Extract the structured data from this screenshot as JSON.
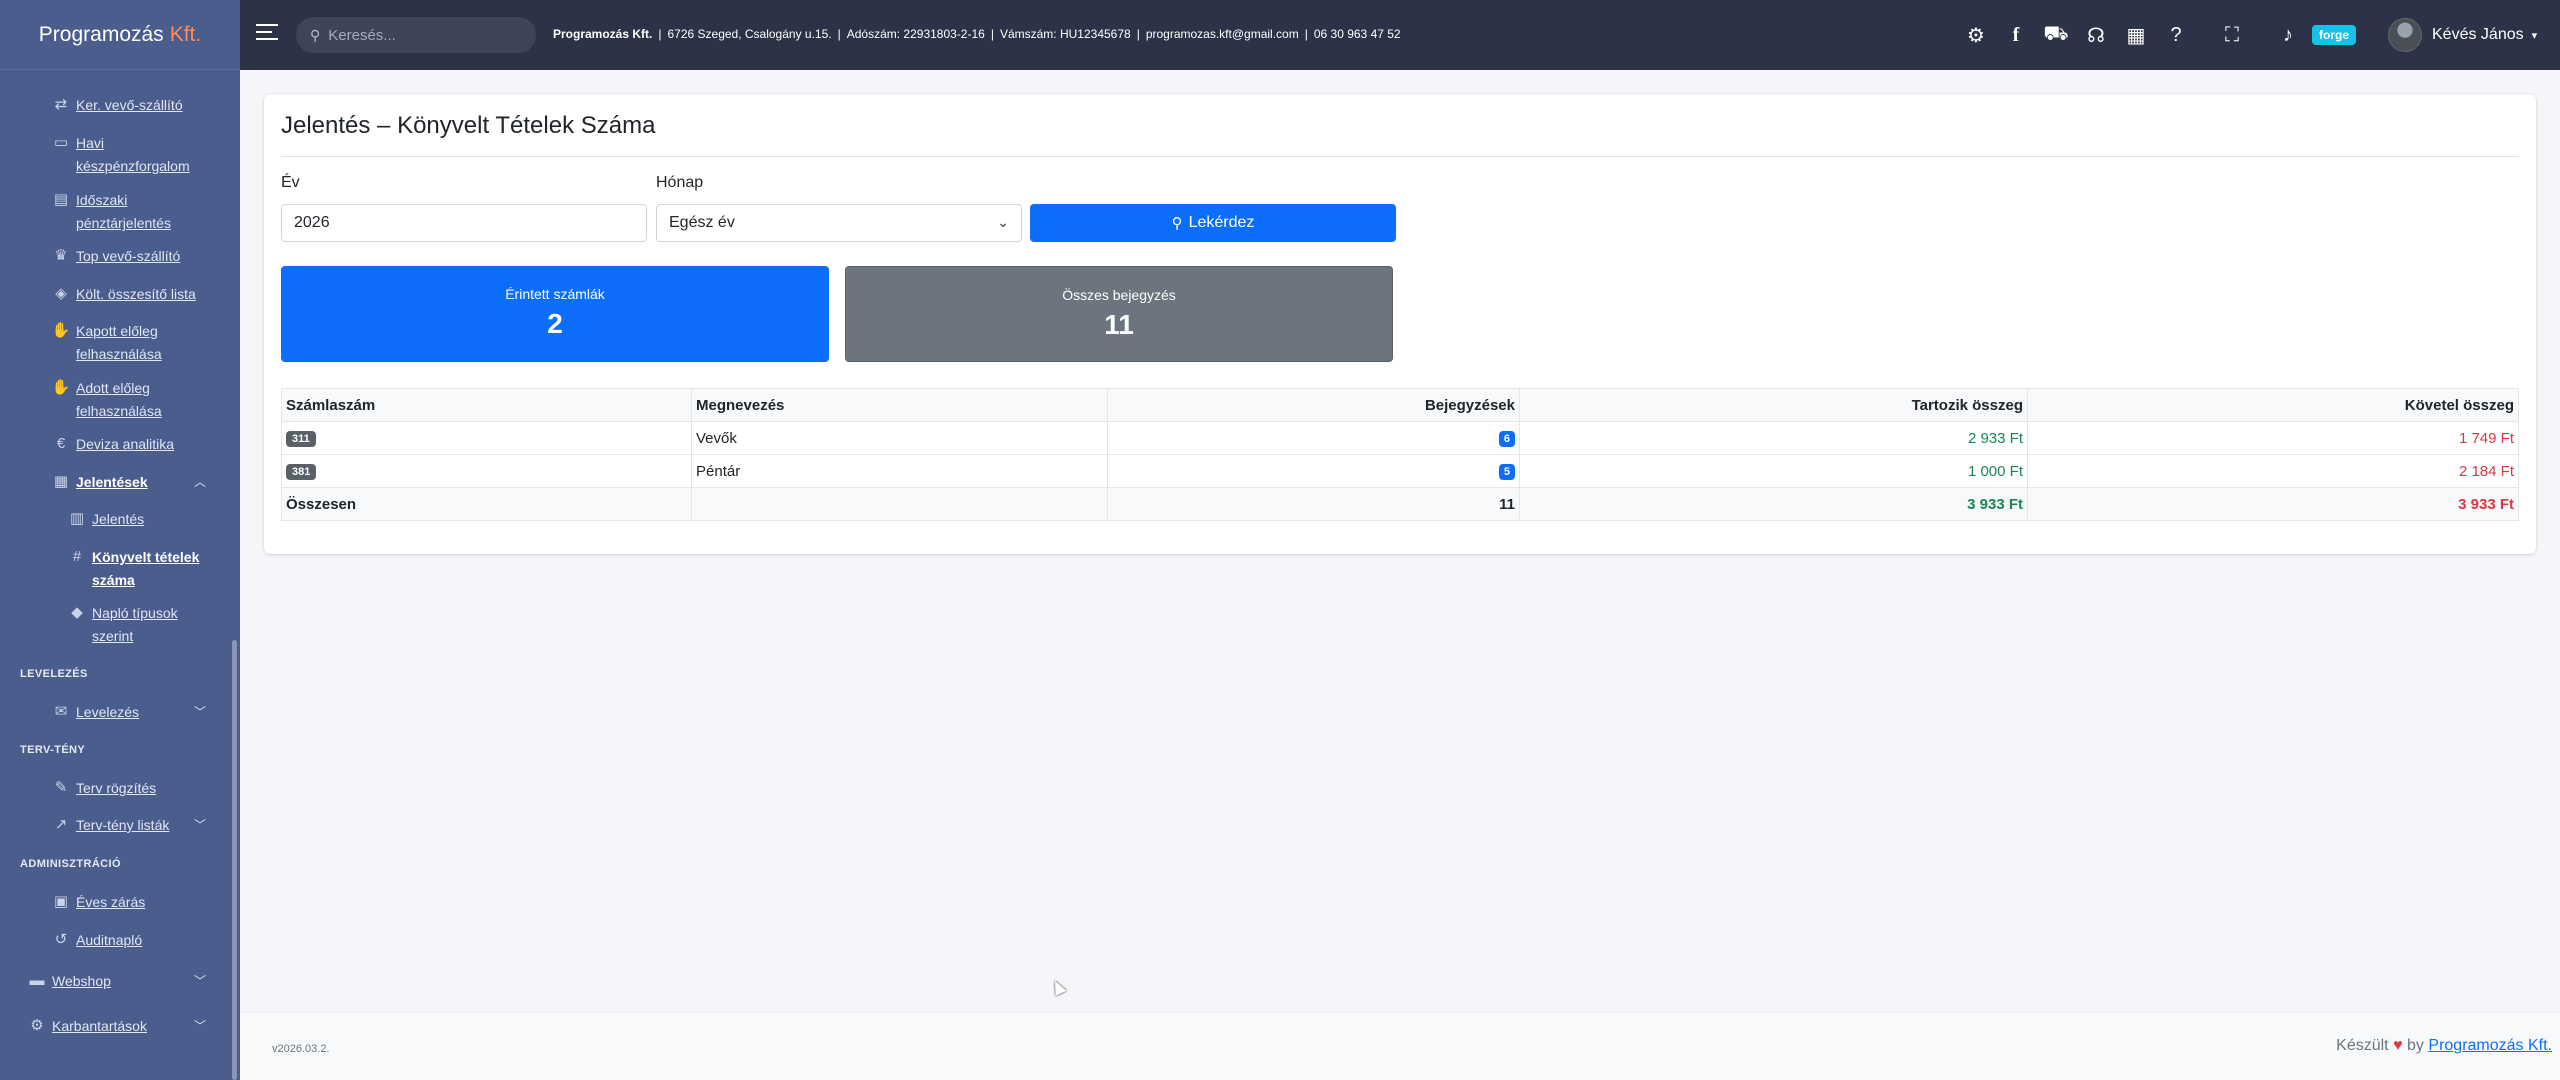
{
  "brand": {
    "name": "Programozás",
    "accent": "Kft."
  },
  "sidebar": {
    "items": [
      {
        "label": "Ker. vevő-szállító",
        "icon": "exchange-icon"
      },
      {
        "label": "Havi készpénzforgalom",
        "icon": "money-icon"
      },
      {
        "label": "Időszaki pénztárjelentés",
        "icon": "cash-register-icon"
      },
      {
        "label": "Top vevő-szállító",
        "icon": "trophy-icon"
      },
      {
        "label": "Költ. összesítő lista",
        "icon": "layers-icon"
      },
      {
        "label": "Kapott előleg felhasználása",
        "icon": "hand-money-icon"
      },
      {
        "label": "Adott előleg felhasználása",
        "icon": "hand-money-icon"
      },
      {
        "label": "Deviza analitika",
        "icon": "euro-icon"
      },
      {
        "label": "Jelentések",
        "icon": "file-icon"
      },
      {
        "label": "Jelentés",
        "icon": "chart-icon"
      },
      {
        "label": "Könyvelt tételek száma",
        "icon": "hash-icon"
      },
      {
        "label": "Napló típusok szerint",
        "icon": "tags-icon"
      },
      {
        "label": "Levelezés",
        "icon": "mailbox-icon"
      },
      {
        "label": "Terv rögzítés",
        "icon": "edit-icon"
      },
      {
        "label": "Terv-tény listák",
        "icon": "line-chart-icon"
      },
      {
        "label": "Éves zárás",
        "icon": "calendar-check-icon"
      },
      {
        "label": "Auditnapló",
        "icon": "history-icon"
      },
      {
        "label": "Webshop",
        "icon": "store-icon"
      },
      {
        "label": "Karbantartások",
        "icon": "gear-icon"
      }
    ],
    "sections": {
      "levelezes": "LEVELEZÉS",
      "tervteny": "TERV-TÉNY",
      "admin": "ADMINISZTRÁCIÓ"
    }
  },
  "topbar": {
    "search_placeholder": "Keresés...",
    "company_name": "Programozás Kft.",
    "address": "6726 Szeged, Csalogány u.15.",
    "tax": "Adószám: 22931803-2-16",
    "vat": "Vámszám: HU12345678",
    "email": "programozas.kft@gmail.com",
    "phone": "06 30 963 47 52",
    "forge_label": "forge",
    "user_name": "Kévés János"
  },
  "page": {
    "title": "Jelentés – Könyvelt Tételek Száma",
    "year_label": "Év",
    "year_value": "2026",
    "month_label": "Hónap",
    "month_value": "Egész év",
    "query_button": "Lekérdez"
  },
  "stats": {
    "accounts_label": "Érintett számlák",
    "accounts_value": "2",
    "entries_label": "Összes bejegyzés",
    "entries_value": "11",
    "accounts_color": "#0d6efd",
    "entries_color": "#6c757d"
  },
  "table": {
    "headers": [
      "Számlaszám",
      "Megnevezés",
      "Bejegyzések",
      "Tartozik összeg",
      "Követel összeg"
    ],
    "rows": [
      {
        "account": "311",
        "name": "Vevők",
        "entries": "6",
        "debit": "2 933 Ft",
        "credit": "1 749 Ft"
      },
      {
        "account": "381",
        "name": "Péntár",
        "entries": "5",
        "debit": "1 000 Ft",
        "credit": "2 184 Ft"
      }
    ],
    "total": {
      "label": "Összesen",
      "entries": "11",
      "debit": "3 933 Ft",
      "credit": "3 933 Ft"
    }
  },
  "footer": {
    "version": "v2026.03.2.",
    "made_prefix": "Készült",
    "made_by": "by",
    "made_link": "Programozás Kft."
  }
}
